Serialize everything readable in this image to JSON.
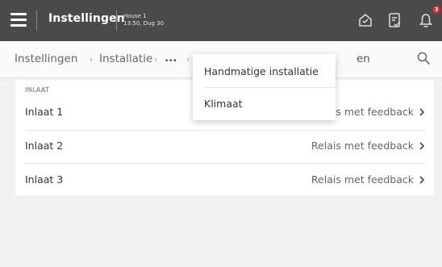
{
  "header": {
    "title": "Instellingen",
    "house": "House 1",
    "datetime": "13:50, Dug 30",
    "notification_count": "3",
    "icons": [
      "menu-icon",
      "home-status-icon",
      "checklist-icon",
      "bell-icon"
    ],
    "badge_color": "#e0252b"
  },
  "breadcrumb": {
    "items": [
      "Instellingen",
      "Installatie",
      "..."
    ],
    "separator": "›",
    "current_partial": "en"
  },
  "section": {
    "label": "INLAAT",
    "rows": [
      {
        "label": "Inlaat 1",
        "value": "Relais met feedback"
      },
      {
        "label": "Inlaat 2",
        "value": "Relais met feedback"
      },
      {
        "label": "Inlaat 3",
        "value": "Relais met feedback"
      }
    ]
  },
  "dropdown": {
    "items": [
      "Handmatige installatie",
      "Klimaat"
    ]
  }
}
